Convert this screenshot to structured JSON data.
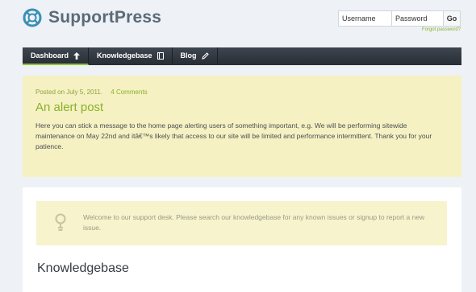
{
  "header": {
    "logo_text": "SupportPress",
    "login": {
      "username_placeholder": "Username",
      "password_placeholder": "Password",
      "go_label": "Go",
      "forgot_label": "Forgot password?"
    }
  },
  "nav": {
    "items": [
      {
        "label": "Dashboard",
        "icon": "arrow-up-icon"
      },
      {
        "label": "Knowledgebase",
        "icon": "book-icon"
      },
      {
        "label": "Blog",
        "icon": "pencil-icon"
      }
    ]
  },
  "alert": {
    "meta_posted": "Posted on July 5, 2011.",
    "meta_comments": "4 Comments",
    "title": "An alert post",
    "body": "Here you can stick a message to the home page alerting users of something important, e.g. We will be performing sitewide maintenance on May 22nd and itâ€™s likely that access to our site will be limited and performance intermittent. Thank you for your patience."
  },
  "main": {
    "welcome_text": "Welcome to our support desk. Please search our knowledgebase for any known issues or signup to report a new issue.",
    "section_title": "Knowledgebase"
  },
  "colors": {
    "accent": "#8ab12a",
    "nav_bg": "#2f363e",
    "alert_bg": "#f5f1c2",
    "page_bg": "#eef1f5"
  }
}
